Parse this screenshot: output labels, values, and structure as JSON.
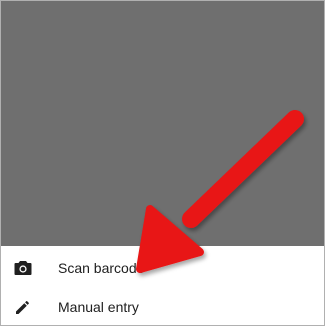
{
  "sheet": {
    "items": [
      {
        "label": "Scan barcode",
        "icon": "camera-icon"
      },
      {
        "label": "Manual entry",
        "icon": "pencil-icon"
      }
    ]
  },
  "annotation": {
    "arrow_color": "#e81416"
  },
  "colors": {
    "scrim": "#6f6f6f",
    "sheet": "#ffffff",
    "text": "#202020"
  }
}
